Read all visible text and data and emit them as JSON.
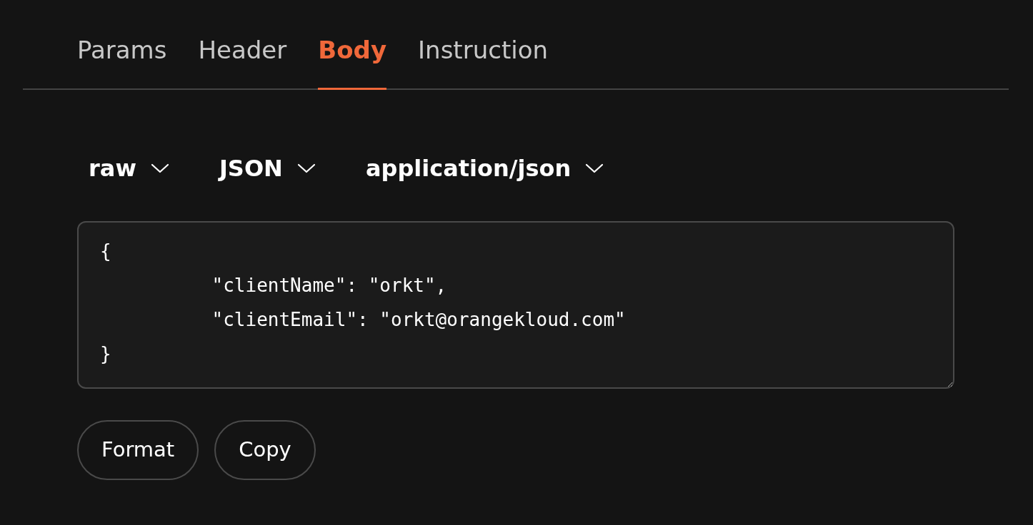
{
  "tabs": [
    {
      "label": "Params",
      "selected": false
    },
    {
      "label": "Header",
      "selected": false
    },
    {
      "label": "Body",
      "selected": true
    },
    {
      "label": "Instruction",
      "selected": false
    }
  ],
  "dropdowns": [
    {
      "label": "raw"
    },
    {
      "label": "JSON"
    },
    {
      "label": "application/json"
    }
  ],
  "body_editor": {
    "value": "{\n\t\"clientName\": \"orkt\",\n\t\"clientEmail\": \"orkt@orangekloud.com\"\n}"
  },
  "buttons": [
    {
      "label": "Format"
    },
    {
      "label": "Copy"
    }
  ]
}
